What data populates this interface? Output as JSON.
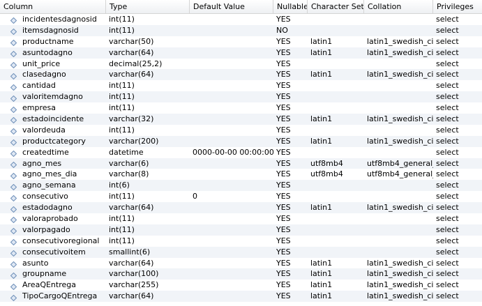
{
  "headers": {
    "column": "Column",
    "type": "Type",
    "default": "Default Value",
    "nullable": "Nullable",
    "charset": "Character Set",
    "collation": "Collation",
    "privileges": "Privileges"
  },
  "icon": "field-diamond-icon",
  "colors": {
    "alt_row": "#f1f4f8",
    "icon_blue": "#6e8fb8"
  },
  "rows": [
    {
      "name": "incidentesdagnosid",
      "type": "int(11)",
      "default": "",
      "nullable": "YES",
      "charset": "",
      "collation": "",
      "privileges": "select"
    },
    {
      "name": "itemsdagnosid",
      "type": "int(11)",
      "default": "",
      "nullable": "NO",
      "charset": "",
      "collation": "",
      "privileges": "select"
    },
    {
      "name": "productname",
      "type": "varchar(50)",
      "default": "",
      "nullable": "YES",
      "charset": "latin1",
      "collation": "latin1_swedish_ci",
      "privileges": "select"
    },
    {
      "name": "asuntodagno",
      "type": "varchar(64)",
      "default": "",
      "nullable": "YES",
      "charset": "latin1",
      "collation": "latin1_swedish_ci",
      "privileges": "select"
    },
    {
      "name": "unit_price",
      "type": "decimal(25,2)",
      "default": "",
      "nullable": "YES",
      "charset": "",
      "collation": "",
      "privileges": "select"
    },
    {
      "name": "clasedagno",
      "type": "varchar(64)",
      "default": "",
      "nullable": "YES",
      "charset": "latin1",
      "collation": "latin1_swedish_ci",
      "privileges": "select"
    },
    {
      "name": "cantidad",
      "type": "int(11)",
      "default": "",
      "nullable": "YES",
      "charset": "",
      "collation": "",
      "privileges": "select"
    },
    {
      "name": "valoritemdagno",
      "type": "int(11)",
      "default": "",
      "nullable": "YES",
      "charset": "",
      "collation": "",
      "privileges": "select"
    },
    {
      "name": "empresa",
      "type": "int(11)",
      "default": "",
      "nullable": "YES",
      "charset": "",
      "collation": "",
      "privileges": "select"
    },
    {
      "name": "estadoincidente",
      "type": "varchar(32)",
      "default": "",
      "nullable": "YES",
      "charset": "latin1",
      "collation": "latin1_swedish_ci",
      "privileges": "select"
    },
    {
      "name": "valordeuda",
      "type": "int(11)",
      "default": "",
      "nullable": "YES",
      "charset": "",
      "collation": "",
      "privileges": "select"
    },
    {
      "name": "productcategory",
      "type": "varchar(200)",
      "default": "",
      "nullable": "YES",
      "charset": "latin1",
      "collation": "latin1_swedish_ci",
      "privileges": "select"
    },
    {
      "name": "createdtime",
      "type": "datetime",
      "default": "0000-00-00 00:00:00",
      "nullable": "YES",
      "charset": "",
      "collation": "",
      "privileges": "select"
    },
    {
      "name": "agno_mes",
      "type": "varchar(6)",
      "default": "",
      "nullable": "YES",
      "charset": "utf8mb4",
      "collation": "utf8mb4_general_ci",
      "privileges": "select"
    },
    {
      "name": "agno_mes_dia",
      "type": "varchar(8)",
      "default": "",
      "nullable": "YES",
      "charset": "utf8mb4",
      "collation": "utf8mb4_general_ci",
      "privileges": "select"
    },
    {
      "name": "agno_semana",
      "type": "int(6)",
      "default": "",
      "nullable": "YES",
      "charset": "",
      "collation": "",
      "privileges": "select"
    },
    {
      "name": "consecutivo",
      "type": "int(11)",
      "default": "0",
      "nullable": "YES",
      "charset": "",
      "collation": "",
      "privileges": "select"
    },
    {
      "name": "estadodagno",
      "type": "varchar(64)",
      "default": "",
      "nullable": "YES",
      "charset": "latin1",
      "collation": "latin1_swedish_ci",
      "privileges": "select"
    },
    {
      "name": "valoraprobado",
      "type": "int(11)",
      "default": "",
      "nullable": "YES",
      "charset": "",
      "collation": "",
      "privileges": "select"
    },
    {
      "name": "valorpagado",
      "type": "int(11)",
      "default": "",
      "nullable": "YES",
      "charset": "",
      "collation": "",
      "privileges": "select"
    },
    {
      "name": "consecutivoregional",
      "type": "int(11)",
      "default": "",
      "nullable": "YES",
      "charset": "",
      "collation": "",
      "privileges": "select"
    },
    {
      "name": "consecutivoitem",
      "type": "smallint(6)",
      "default": "",
      "nullable": "YES",
      "charset": "",
      "collation": "",
      "privileges": "select"
    },
    {
      "name": "asunto",
      "type": "varchar(64)",
      "default": "",
      "nullable": "YES",
      "charset": "latin1",
      "collation": "latin1_swedish_ci",
      "privileges": "select"
    },
    {
      "name": "groupname",
      "type": "varchar(100)",
      "default": "",
      "nullable": "YES",
      "charset": "latin1",
      "collation": "latin1_swedish_ci",
      "privileges": "select"
    },
    {
      "name": "AreaQEntrega",
      "type": "varchar(255)",
      "default": "",
      "nullable": "YES",
      "charset": "latin1",
      "collation": "latin1_swedish_ci",
      "privileges": "select"
    },
    {
      "name": "TipoCargoQEntrega",
      "type": "varchar(64)",
      "default": "",
      "nullable": "YES",
      "charset": "latin1",
      "collation": "latin1_swedish_ci",
      "privileges": "select"
    }
  ]
}
